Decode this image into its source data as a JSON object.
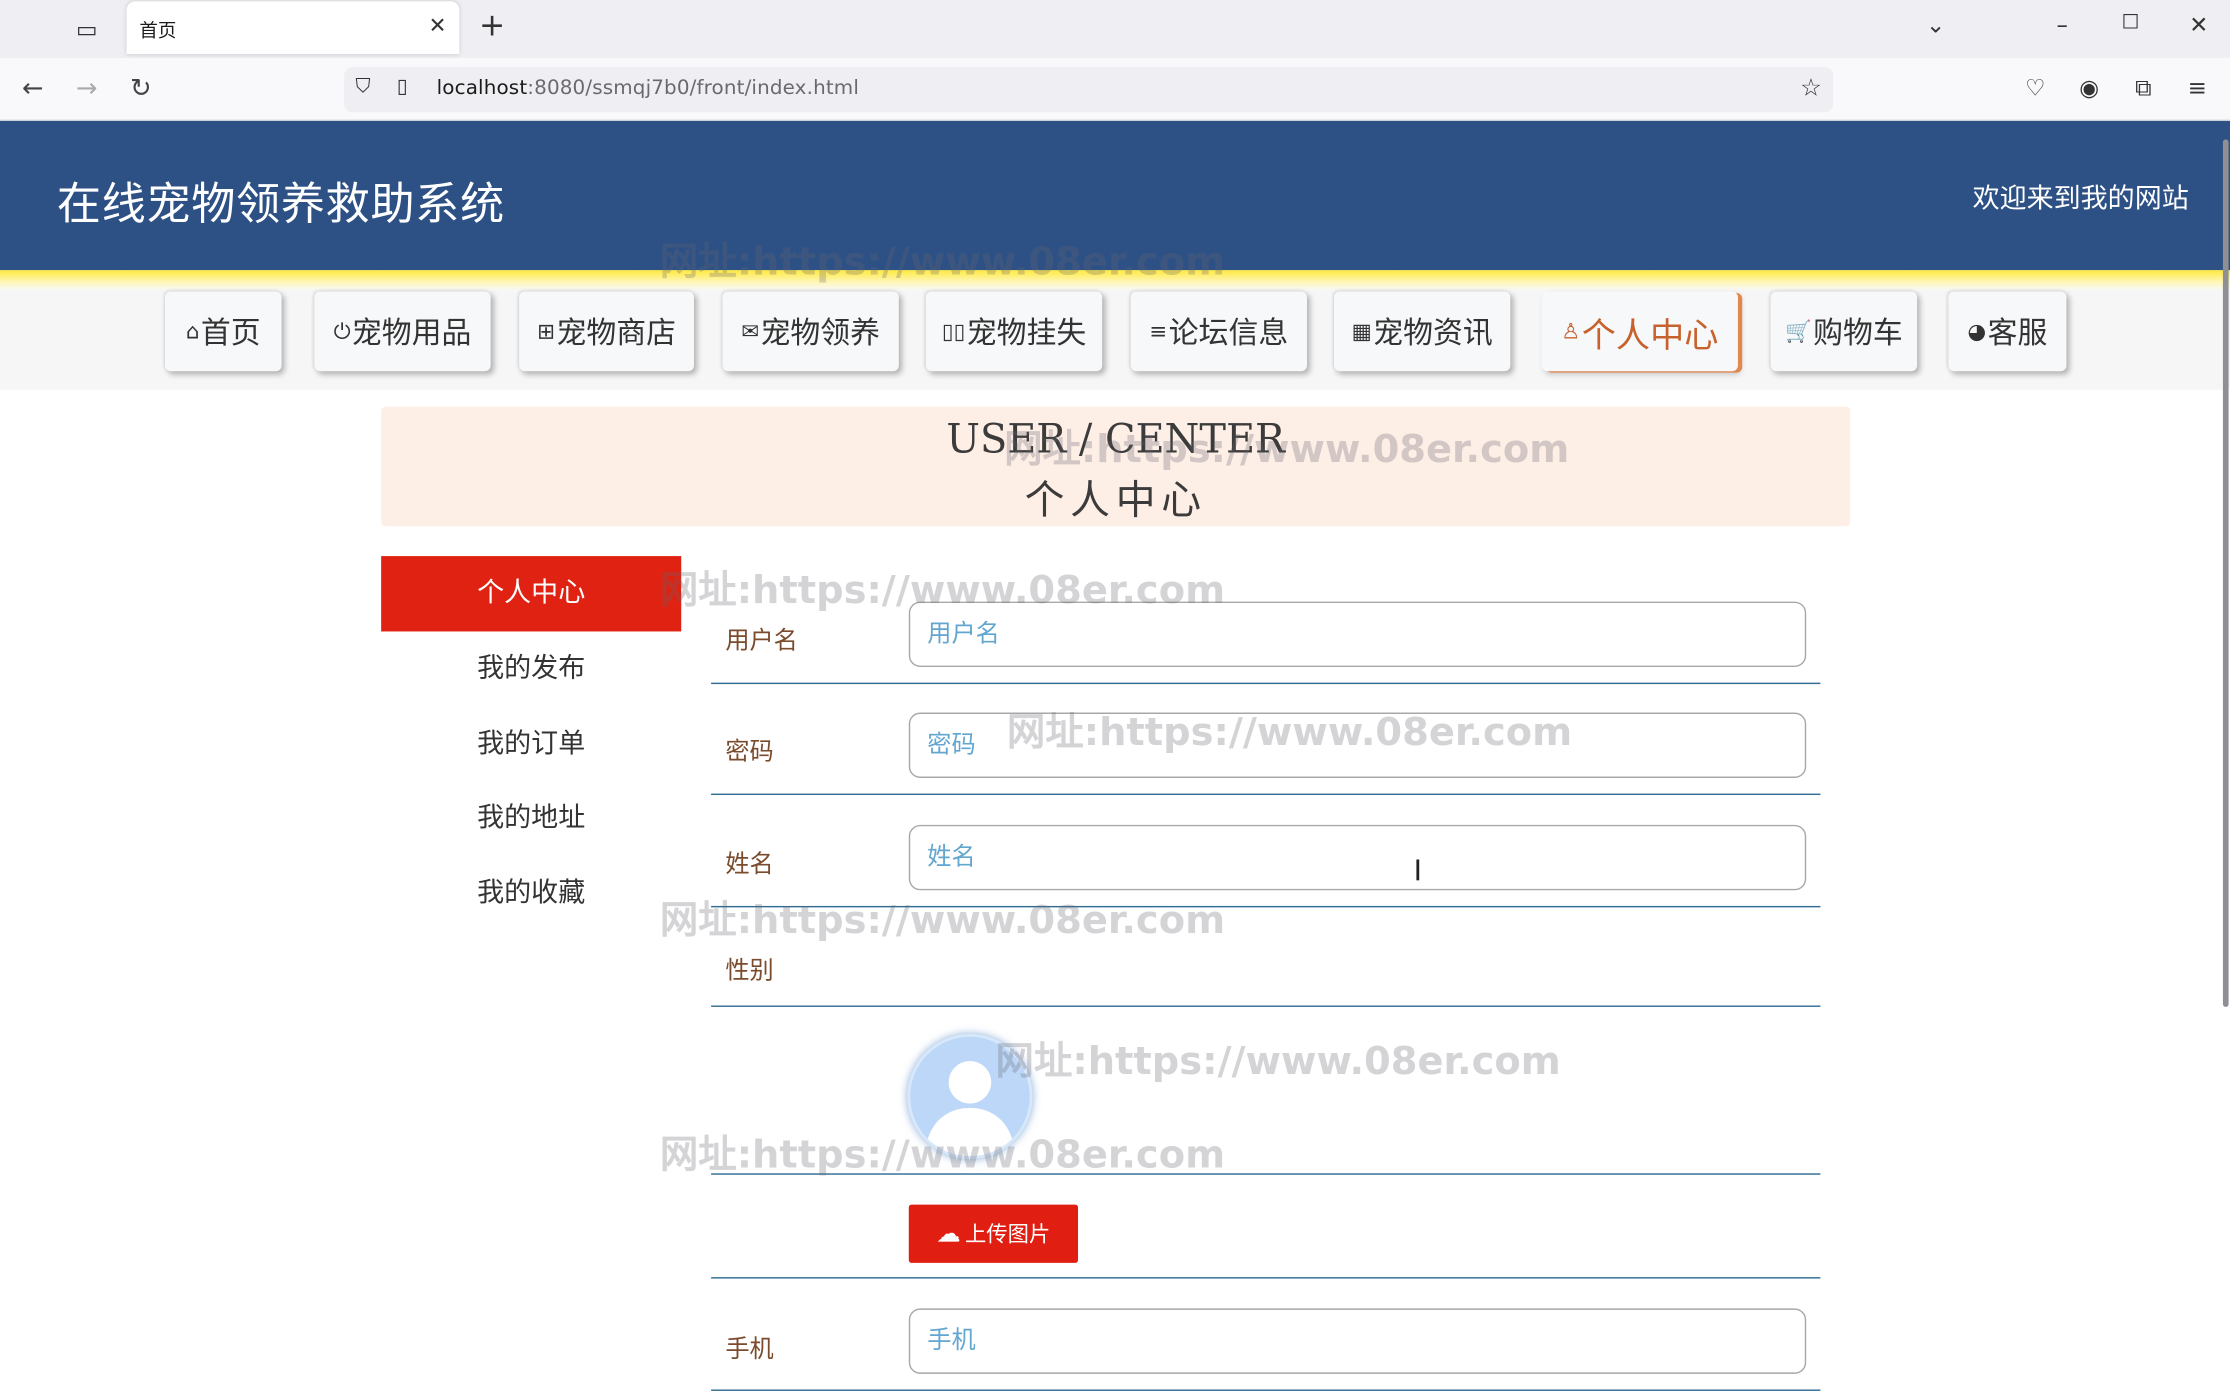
{
  "browser": {
    "tab_title": "首页",
    "tab_close": "✕",
    "new_tab": "+",
    "url_host": "localhost",
    "url_rest": ":8080/ssmqj7b0/front/index.html",
    "window_controls": [
      "⌄",
      "–",
      "☐",
      "✕"
    ]
  },
  "site": {
    "title": "在线宠物领养救助系统",
    "welcome": "欢迎来到我的网站"
  },
  "menu": [
    {
      "label": "首页",
      "icon": "home-icon",
      "glyph": "⌂"
    },
    {
      "label": "宠物用品",
      "icon": "power-icon",
      "glyph": "⏻"
    },
    {
      "label": "宠物商店",
      "icon": "gift-icon",
      "glyph": "⊞"
    },
    {
      "label": "宠物领养",
      "icon": "mail-icon",
      "glyph": "✉"
    },
    {
      "label": "宠物挂失",
      "icon": "columns-icon",
      "glyph": "▯▯"
    },
    {
      "label": "论坛信息",
      "icon": "sliders-icon",
      "glyph": "≡"
    },
    {
      "label": "宠物资讯",
      "icon": "grid-icon",
      "glyph": "▦"
    },
    {
      "label": "个人中心",
      "icon": "user-icon",
      "glyph": "♙"
    },
    {
      "label": "购物车",
      "icon": "cart-icon",
      "glyph": "🛒"
    },
    {
      "label": "客服",
      "icon": "chat-icon",
      "glyph": "◕"
    }
  ],
  "banner": {
    "en": "USER / CENTER",
    "cn": "个人中心"
  },
  "sidebar": [
    {
      "label": "个人中心"
    },
    {
      "label": "我的发布"
    },
    {
      "label": "我的订单"
    },
    {
      "label": "我的地址"
    },
    {
      "label": "我的收藏"
    }
  ],
  "form": {
    "username": {
      "label": "用户名",
      "placeholder": "用户名",
      "value": ""
    },
    "password": {
      "label": "密码",
      "placeholder": "密码",
      "value": ""
    },
    "name": {
      "label": "姓名",
      "placeholder": "姓名",
      "value": ""
    },
    "gender": {
      "label": "性别"
    },
    "upload_label": "上传图片",
    "phone": {
      "label": "手机",
      "placeholder": "手机",
      "value": ""
    }
  },
  "watermark": "网址:https://www.08er.com",
  "colors": {
    "header_bg": "#2d5185",
    "accent_red": "#df2211",
    "active_menu": "#c8622d",
    "banner_bg": "#fdeee6"
  }
}
